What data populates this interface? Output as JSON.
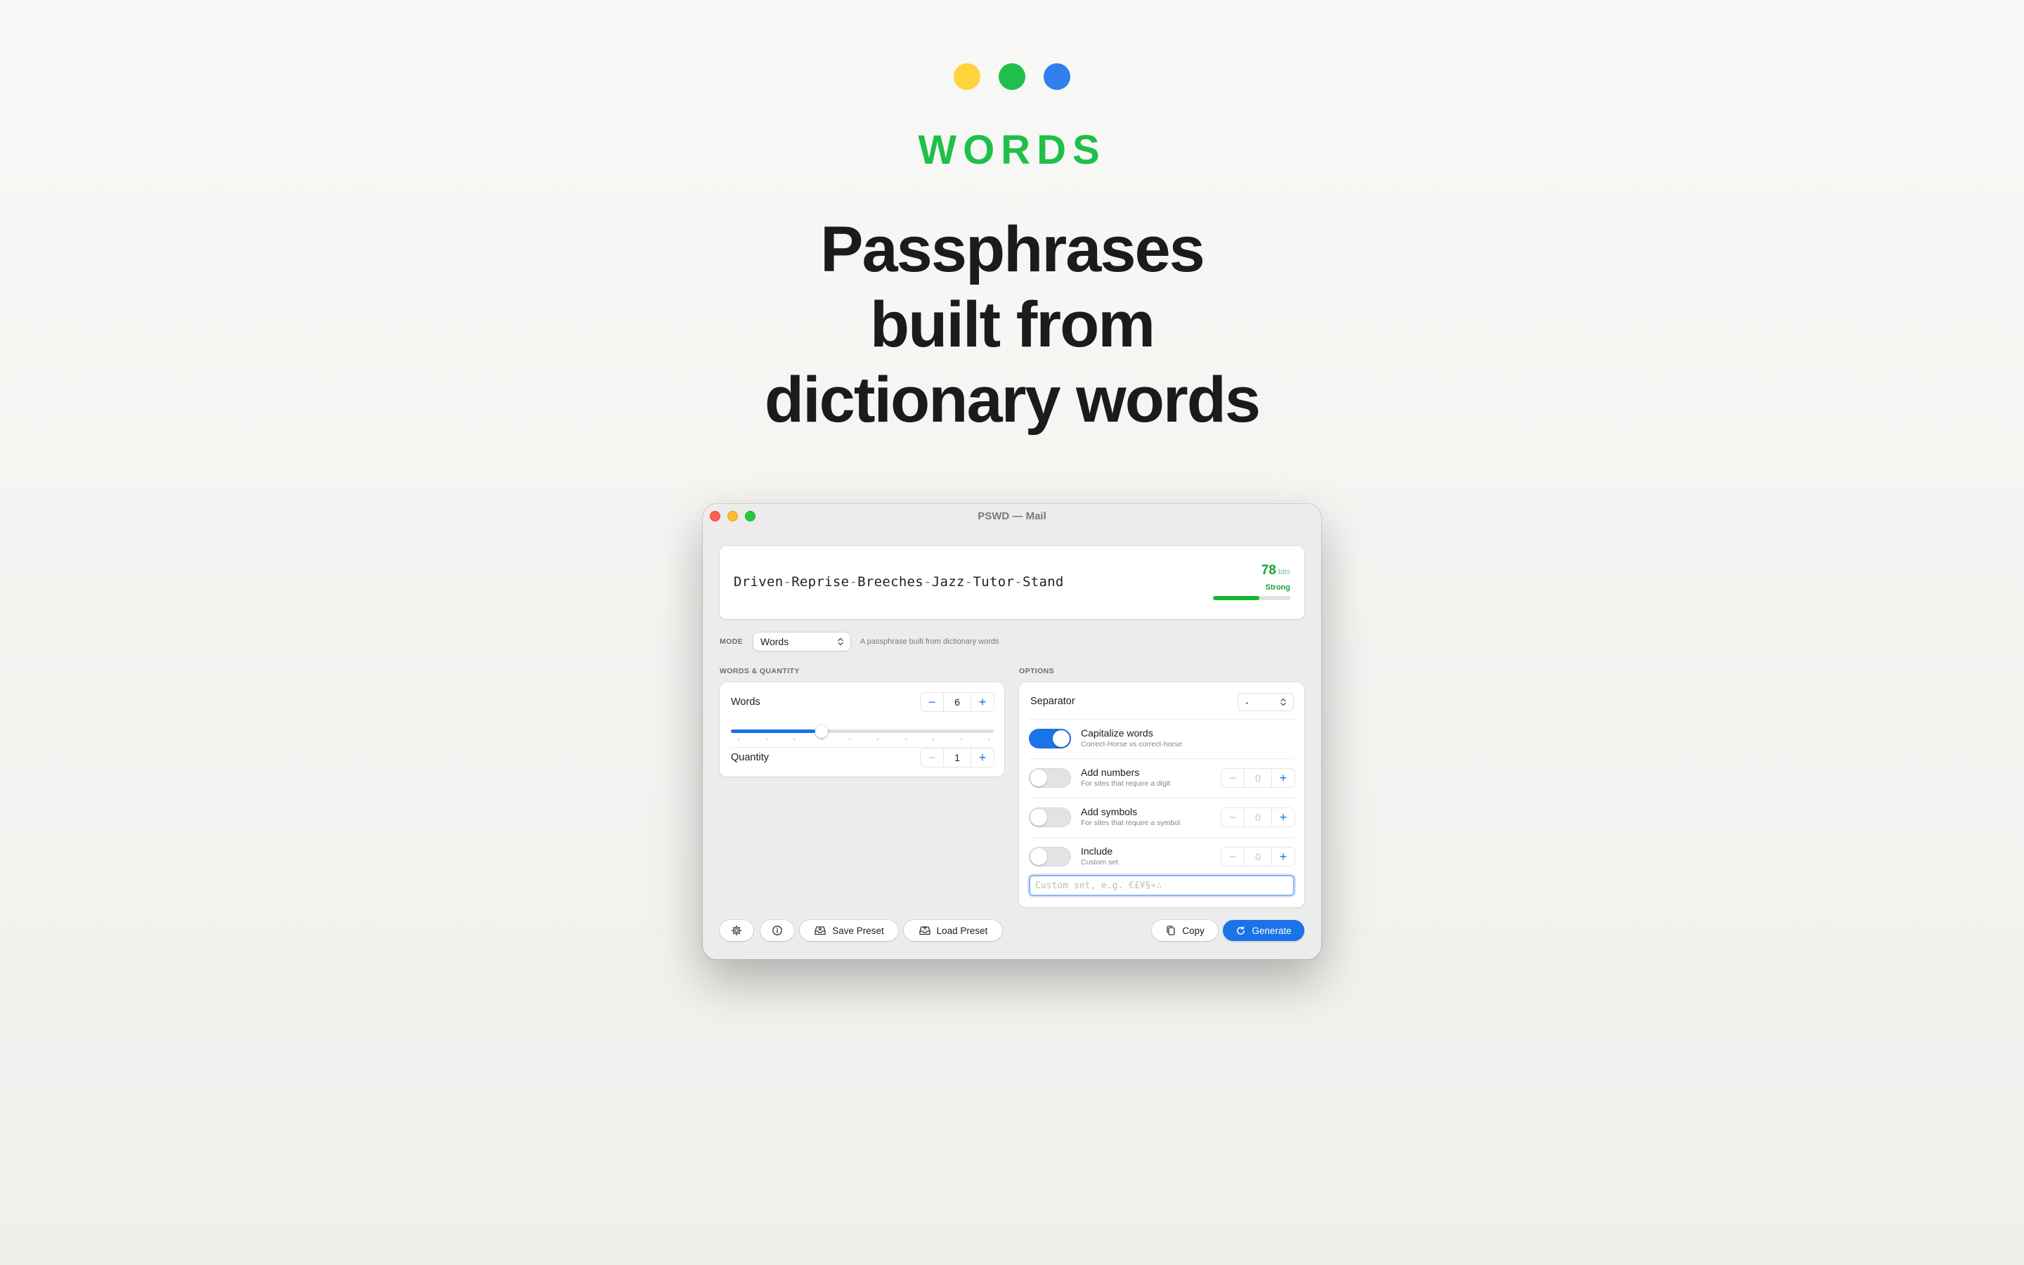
{
  "hero": {
    "dot_colors": [
      "#ffd43b",
      "#1fbf4a",
      "#2f80ed"
    ],
    "eyebrow": "WORDS",
    "headline_lines": [
      "Passphrases",
      "built from",
      "dictionary words"
    ]
  },
  "window": {
    "title": "PSWD — Mail",
    "output": {
      "words": [
        "Driven",
        "Reprise",
        "Breeches",
        "Jazz",
        "Tutor",
        "Stand"
      ],
      "separator": "-",
      "bits": "78",
      "bits_unit": "bits",
      "strength_label": "Strong",
      "strength_fraction": 0.6
    },
    "mode": {
      "label": "MODE",
      "value": "Words",
      "description": "A passphrase built from dictionary words"
    },
    "words_quantity": {
      "section_label": "WORDS & QUANTITY",
      "words_label": "Words",
      "words_value": "6",
      "words_slider_fraction": 0.32,
      "quantity_label": "Quantity",
      "quantity_value": "1"
    },
    "options": {
      "section_label": "OPTIONS",
      "separator_label": "Separator",
      "separator_value": "-",
      "capitalize": {
        "title": "Capitalize words",
        "subtitle": "Correct-Horse vs correct-horse",
        "on": true
      },
      "numbers": {
        "title": "Add numbers",
        "subtitle": "For sites that require a digit",
        "value": "0",
        "on": false
      },
      "symbols": {
        "title": "Add symbols",
        "subtitle": "For sites that require a symbol",
        "value": "0",
        "on": false
      },
      "include": {
        "title": "Include",
        "subtitle": "Custom set",
        "value": "0",
        "on": false
      },
      "custom_placeholder": "Custom set, e.g. €£¥§∗∴"
    },
    "footer": {
      "save_preset": "Save Preset",
      "load_preset": "Load Preset",
      "copy": "Copy",
      "generate": "Generate"
    }
  }
}
